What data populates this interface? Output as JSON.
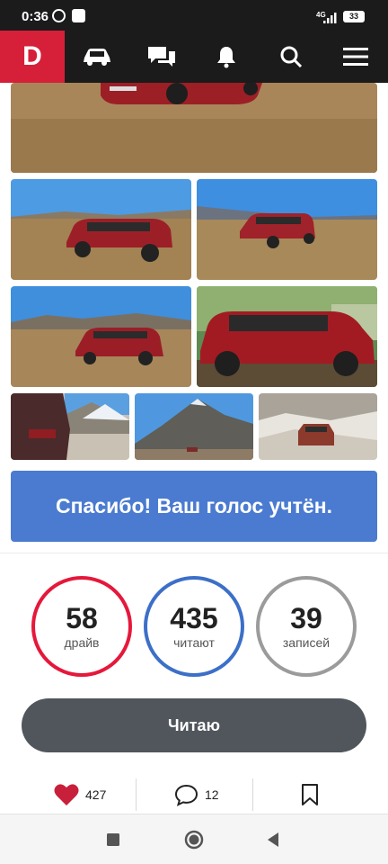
{
  "status_bar": {
    "time": "0:36",
    "network": "4G",
    "battery": "33"
  },
  "app": {
    "logo": "D",
    "nav_icons": [
      "car-icon",
      "chat-icon",
      "bell-icon",
      "search-icon",
      "menu-icon"
    ]
  },
  "vote": {
    "message": "Спасибо! Ваш голос учтён."
  },
  "stats": [
    {
      "value": "58",
      "label": "драйв",
      "color": "#e5183b"
    },
    {
      "value": "435",
      "label": "читают",
      "color": "#3c6fc8"
    },
    {
      "value": "39",
      "label": "записей",
      "color": "#9b9b9b"
    }
  ],
  "read_button": {
    "label": "Читаю"
  },
  "actions": {
    "likes": "427",
    "comments": "12"
  },
  "colors": {
    "brand": "#d6203a",
    "header": "#1b1b1b",
    "banner": "#4a7bd0",
    "button": "#50565c",
    "like": "#c8203a"
  }
}
